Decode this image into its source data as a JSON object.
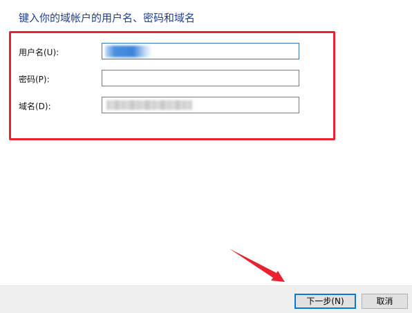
{
  "dialog": {
    "heading": "键入你的域帐户的用户名、密码和域名"
  },
  "fields": {
    "username": {
      "label": "用户名(U):",
      "value": ""
    },
    "password": {
      "label": "密码(P):",
      "value": ""
    },
    "domain": {
      "label": "域名(D):",
      "value": ""
    }
  },
  "buttons": {
    "next_label": "下一步(N)",
    "cancel_label": "取消"
  },
  "annotation": {
    "box_color": "#e8232f",
    "arrow_color": "#e8232f"
  }
}
